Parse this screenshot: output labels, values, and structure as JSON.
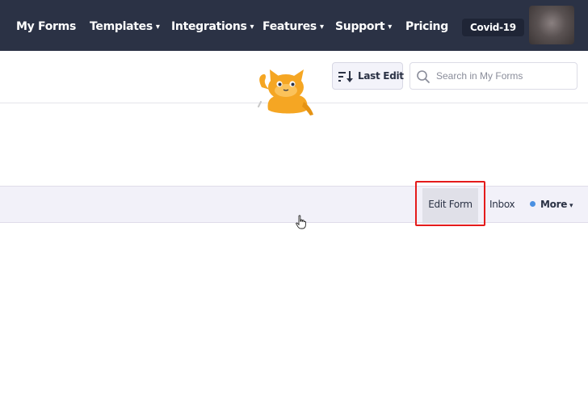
{
  "nav": {
    "my_forms": "My Forms",
    "templates": "Templates",
    "integrations": "Integrations",
    "features": "Features",
    "support": "Support",
    "pricing": "Pricing",
    "covid_badge": "Covid-19",
    "caret_glyph": "▾"
  },
  "toolbar": {
    "sort_label": "Last Edit",
    "sort_icon": "sort-descending-icon",
    "search_placeholder": "Search in My Forms",
    "search_value": "",
    "search_icon": "magnifier-icon"
  },
  "form_row": {
    "edit_form": "Edit Form",
    "inbox": "Inbox",
    "more": "More",
    "more_caret": "▾",
    "status_dot_color": "#4a90e2"
  },
  "colors": {
    "nav_background": "#2b3245",
    "highlight": "#e41b1b",
    "mascot": "#f5a623"
  }
}
